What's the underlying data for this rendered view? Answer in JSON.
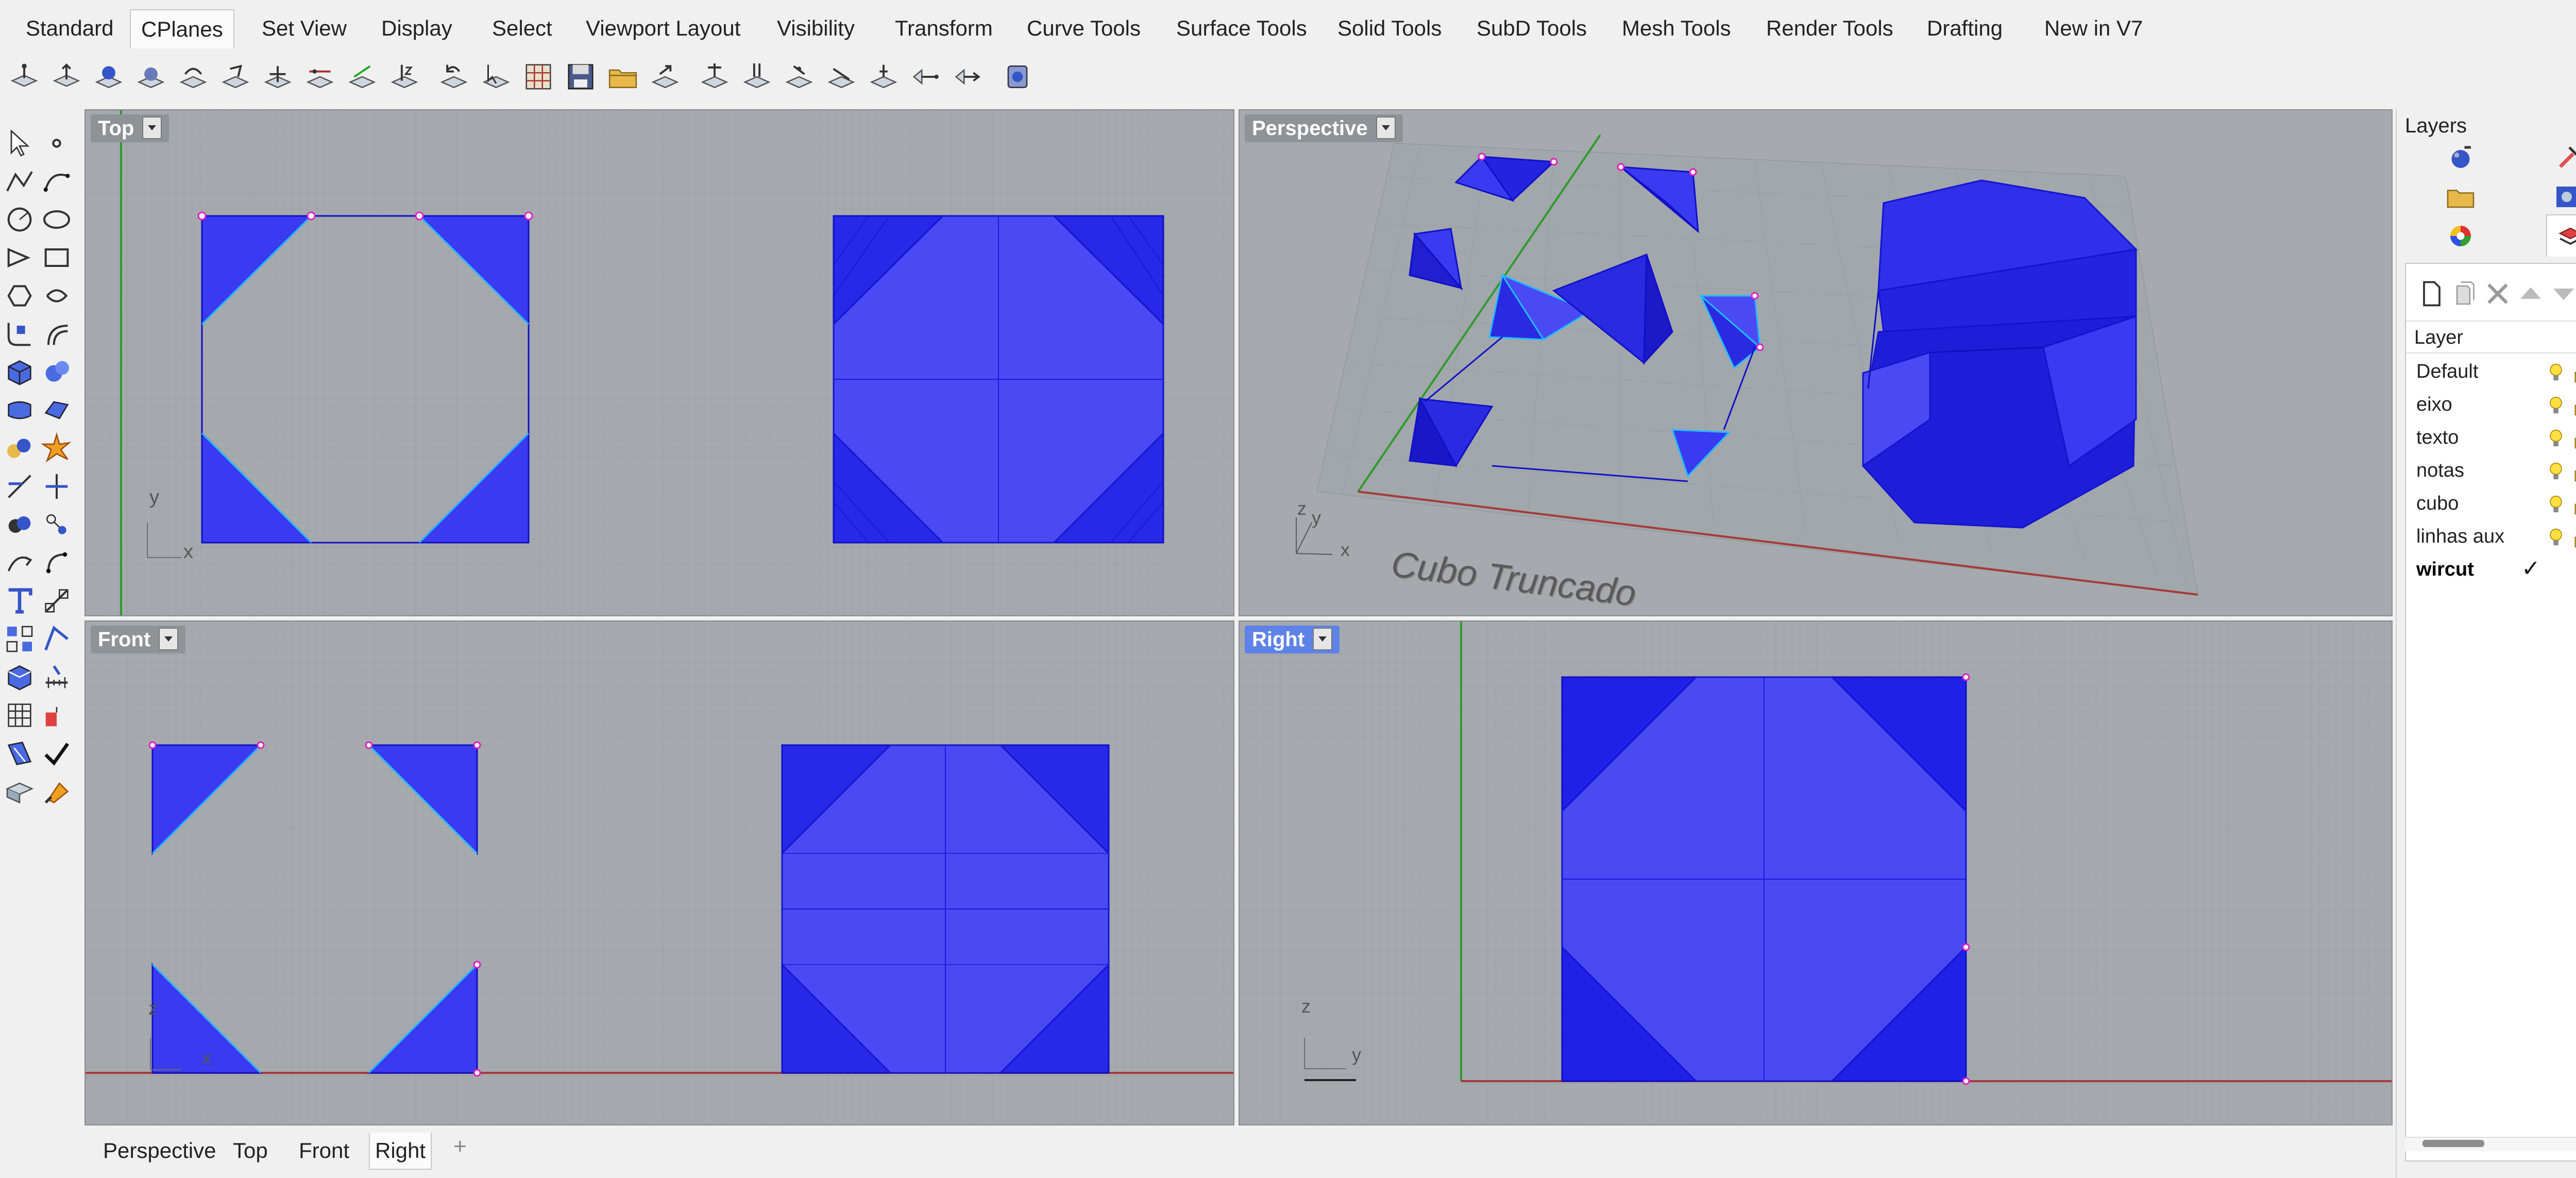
{
  "menu_tabs": [
    {
      "label": "Standard",
      "active": false
    },
    {
      "label": "CPlanes",
      "active": true
    },
    {
      "label": "Set View",
      "active": false
    },
    {
      "label": "Display",
      "active": false
    },
    {
      "label": "Select",
      "active": false
    },
    {
      "label": "Viewport Layout",
      "active": false
    },
    {
      "label": "Visibility",
      "active": false
    },
    {
      "label": "Transform",
      "active": false
    },
    {
      "label": "Curve Tools",
      "active": false
    },
    {
      "label": "Surface Tools",
      "active": false
    },
    {
      "label": "Solid Tools",
      "active": false
    },
    {
      "label": "SubD Tools",
      "active": false
    },
    {
      "label": "Mesh Tools",
      "active": false
    },
    {
      "label": "Render Tools",
      "active": false
    },
    {
      "label": "Drafting",
      "active": false
    },
    {
      "label": "New in V7",
      "active": false
    }
  ],
  "viewports": {
    "top": {
      "title": "Top",
      "axis_x": "x",
      "axis_y": "y"
    },
    "perspective": {
      "title": "Perspective",
      "axis_x": "x",
      "axis_y": "y",
      "axis_z": "z",
      "annotation": "Cubo Truncado"
    },
    "front": {
      "title": "Front",
      "axis_x": "x",
      "axis_z": "z"
    },
    "right": {
      "title": "Right",
      "axis_y": "y",
      "axis_z": "z",
      "active": true
    }
  },
  "view_tabs": [
    {
      "label": "Perspective",
      "active": false
    },
    {
      "label": "Top",
      "active": false
    },
    {
      "label": "Front",
      "active": false
    },
    {
      "label": "Right",
      "active": true
    }
  ],
  "layers_panel": {
    "title": "Layers",
    "column_header": "Layer",
    "layers": [
      {
        "name": "Default",
        "color": "#000000",
        "current": false
      },
      {
        "name": "eixo",
        "color": "#22dd22",
        "current": false
      },
      {
        "name": "texto",
        "color": "#ffff00",
        "current": false
      },
      {
        "name": "notas",
        "color": "#ff0000",
        "current": false
      },
      {
        "name": "cubo",
        "color": "#0000ff",
        "current": false
      },
      {
        "name": "linhas aux",
        "color": "#ff00ff",
        "current": false
      },
      {
        "name": "wircut",
        "color": "#00ffff",
        "current": true
      }
    ]
  },
  "colors": {
    "viewport_bg": "#a6aaae",
    "object_fill": "#3a3af0",
    "object_edge": "#1010c8",
    "x_axis": "#a63a3a",
    "y_axis": "#2e9a2e",
    "active_viewport_title": "#5f82e8"
  }
}
